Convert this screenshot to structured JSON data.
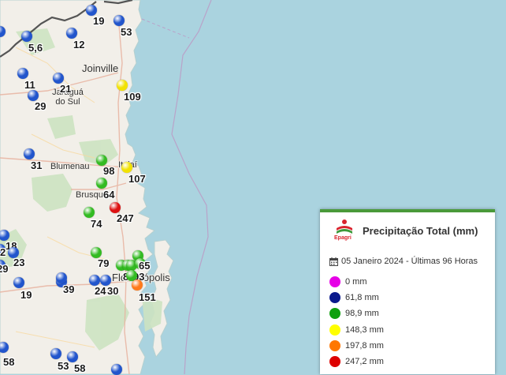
{
  "legend": {
    "logo_text": "Epagri",
    "title": "Precipitação Total (mm)",
    "date_range": "05 Janeiro 2024 - Últimas 96 Horas",
    "classes": [
      {
        "label": "0 mm",
        "color": "#e600e6"
      },
      {
        "label": "61,8 mm",
        "color": "#0a1a8c"
      },
      {
        "label": "98,9 mm",
        "color": "#10a010"
      },
      {
        "label": "148,3 mm",
        "color": "#ffff00"
      },
      {
        "label": "197,8 mm",
        "color": "#ff7700"
      },
      {
        "label": "247,2 mm",
        "color": "#dd0000"
      }
    ]
  },
  "cities": [
    {
      "name": "Joinville",
      "big": true
    },
    {
      "name": "Jaraguá do Sul",
      "big": false
    },
    {
      "name": "Blumenau",
      "big": false
    },
    {
      "name": "Itajaí",
      "big": false
    },
    {
      "name": "Brusque",
      "big": false
    },
    {
      "name": "Florianópolis",
      "big": true
    }
  ],
  "stations": [
    {
      "value": "19",
      "color": "#2255cc"
    },
    {
      "value": "53",
      "color": "#2255cc"
    },
    {
      "value": "5,6",
      "color": "#2255cc"
    },
    {
      "value": "12",
      "color": "#2255cc"
    },
    {
      "value": "",
      "color": "#2255cc"
    },
    {
      "value": "11",
      "color": "#2255cc"
    },
    {
      "value": "21",
      "color": "#2255cc"
    },
    {
      "value": "29",
      "color": "#2255cc"
    },
    {
      "value": "109",
      "color": "#f2e200"
    },
    {
      "value": "31",
      "color": "#2255cc"
    },
    {
      "value": "98",
      "color": "#33bb22"
    },
    {
      "value": "107",
      "color": "#f2e200"
    },
    {
      "value": "64",
      "color": "#33bb22"
    },
    {
      "value": "247",
      "color": "#dd1111"
    },
    {
      "value": "74",
      "color": "#33bb22"
    },
    {
      "value": "18",
      "color": "#2255cc"
    },
    {
      "value": "2",
      "color": "#2255cc"
    },
    {
      "value": "23",
      "color": "#2255cc"
    },
    {
      "value": "29",
      "color": "#2255cc"
    },
    {
      "value": "79",
      "color": "#33bb22"
    },
    {
      "value": "",
      "color": "#33bb22"
    },
    {
      "value": "8",
      "color": "#33bb22"
    },
    {
      "value": "",
      "color": "#33bb22"
    },
    {
      "value": "93",
      "color": "#33bb22"
    },
    {
      "value": "65",
      "color": "#33bb22"
    },
    {
      "value": "",
      "color": "#33bb22"
    },
    {
      "value": "151",
      "color": "#ff7a1a"
    },
    {
      "value": "19",
      "color": "#2255cc"
    },
    {
      "value": "39",
      "color": "#2255cc"
    },
    {
      "value": "",
      "color": "#2255cc"
    },
    {
      "value": "24",
      "color": "#2255cc"
    },
    {
      "value": "30",
      "color": "#2255cc"
    },
    {
      "value": "58",
      "color": "#2255cc"
    },
    {
      "value": "53",
      "color": "#2255cc"
    },
    {
      "value": "58",
      "color": "#2255cc"
    },
    {
      "value": "",
      "color": "#2255cc"
    }
  ]
}
